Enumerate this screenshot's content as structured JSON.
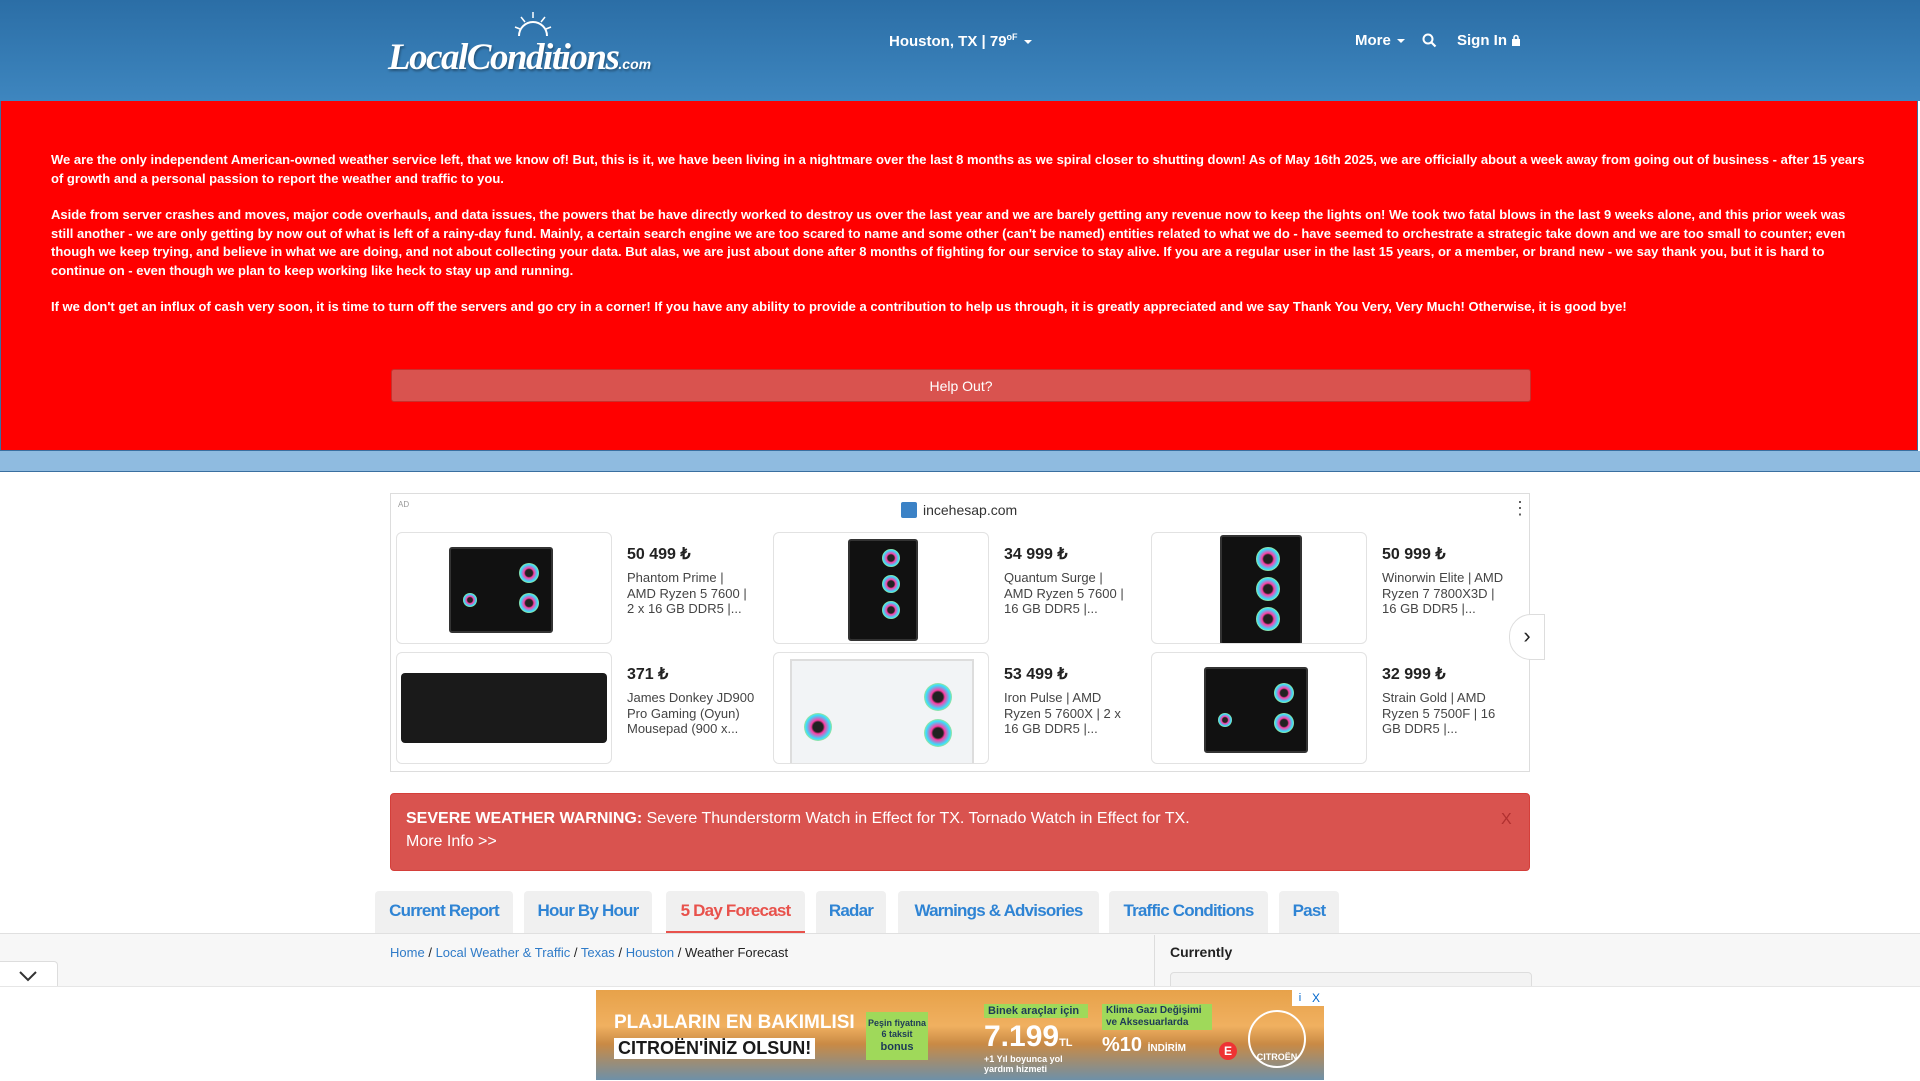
{
  "header": {
    "logo_text": "LocalConditions",
    "logo_suffix": ".com",
    "location": "Houston, TX | 79",
    "temp_unit": "oF",
    "more_label": "More",
    "signin_label": "Sign In"
  },
  "banner": {
    "p1": "We are the only independent American-owned weather service left, that we know of! But, this is it, we have been living in a nightmare over the last 8 months as we spiral closer to shutting down! As of May 16th 2025, we are officially about a week away from going out of business - after 15 years of growth and a personal passion to report the weather and traffic to you.",
    "p2": "Aside from server crashes and moves, major code overhauls, and data issues, the powers that be have directly worked to destroy us over the last year and we are barely getting any revenue now to keep the lights on! We took two fatal blows in the last 9 weeks alone, and this prior week was still another - we are only getting by now out of what is left of a rainy-day fund. Mainly, a certain search engine we are too scared to name and some other (can't be named) entities related to what we do - have seemed to orchestrate a strategic take down and we are too small to counter; even though we keep trying, and believe in what we are doing, and not about collecting your data. But alas, we are just about done after 8 months of fighting for our service to stay alive. If you are a regular user in the last 15 years, or a member, or brand new - we say thank you, but it is hard to continue on - even though we plan to keep working like heck to stay up and running.",
    "p3": "If we don't get an influx of cash very soon, it is time to turn off the servers and go cry in a corner! If you have any ability to provide a contribution to help us through, it is greatly appreciated and we say Thank You Very, Very Much! Otherwise, it is good bye!",
    "button_label": "Help Out?"
  },
  "ad": {
    "label": "AD",
    "domain": "incehesap.com",
    "menu_icon": "⋮",
    "next_icon": "›",
    "items": [
      {
        "price": "50 499 ₺",
        "title": "Phantom Prime | AMD Ryzen 5 7600 | 2 x 16 GB DDR5 |..."
      },
      {
        "price": "34 999 ₺",
        "title": "Quantum Surge | AMD Ryzen 5 7600 | 16 GB DDR5 |..."
      },
      {
        "price": "50 999 ₺",
        "title": "Winorwin Elite | AMD Ryzen 7 7800X3D | 16 GB DDR5 |..."
      },
      {
        "price": "371 ₺",
        "title": "James Donkey JD900 Pro Gaming (Oyun) Mousepad (900 x..."
      },
      {
        "price": "53 499 ₺",
        "title": "Iron Pulse | AMD Ryzen 5 7600X | 2 x 16 GB DDR5 |..."
      },
      {
        "price": "32 999 ₺",
        "title": "Strain Gold | AMD Ryzen 5 7500F | 16 GB DDR5 |..."
      }
    ]
  },
  "warning": {
    "label": "SEVERE WEATHER WARNING:",
    "text": "Severe Thunderstorm Watch in Effect for TX.  Tornado Watch in Effect for TX.",
    "more": "More Info >>",
    "close": "X"
  },
  "tabs": [
    {
      "label": "Current Report"
    },
    {
      "label": "Hour By Hour"
    },
    {
      "label": "5 Day Forecast"
    },
    {
      "label": "Radar"
    },
    {
      "label": "Warnings & Advisories"
    },
    {
      "label": "Traffic Conditions"
    },
    {
      "label": "Past"
    }
  ],
  "breadcrumb": {
    "home": "Home",
    "local": "Local Weather & Traffic",
    "state": "Texas",
    "city": "Houston",
    "current": "Weather Forecast",
    "sep": "/"
  },
  "sidebar": {
    "currently": "Currently"
  },
  "bottom_ad": {
    "line1": "PLAJLARIN EN BAKIMLISI",
    "line2": "CITROËN'İNİZ OLSUN!",
    "box1": "Peşin fiyatına 6 taksit",
    "box1_brand": "bonus",
    "box2_top": "Binek araçlar için",
    "box2_price": "7.199",
    "box2_unit": "TL",
    "box2_note": "+1 Yıl boyunca yol yardım hizmeti",
    "box3_top": "Klima Gazı Değişimi ve Aksesuarlarda",
    "box3_pct": "%10",
    "box3_discount": "İNDİRİM",
    "e_badge": "E",
    "brand": "CITROËN",
    "close": "X",
    "info": "i"
  }
}
